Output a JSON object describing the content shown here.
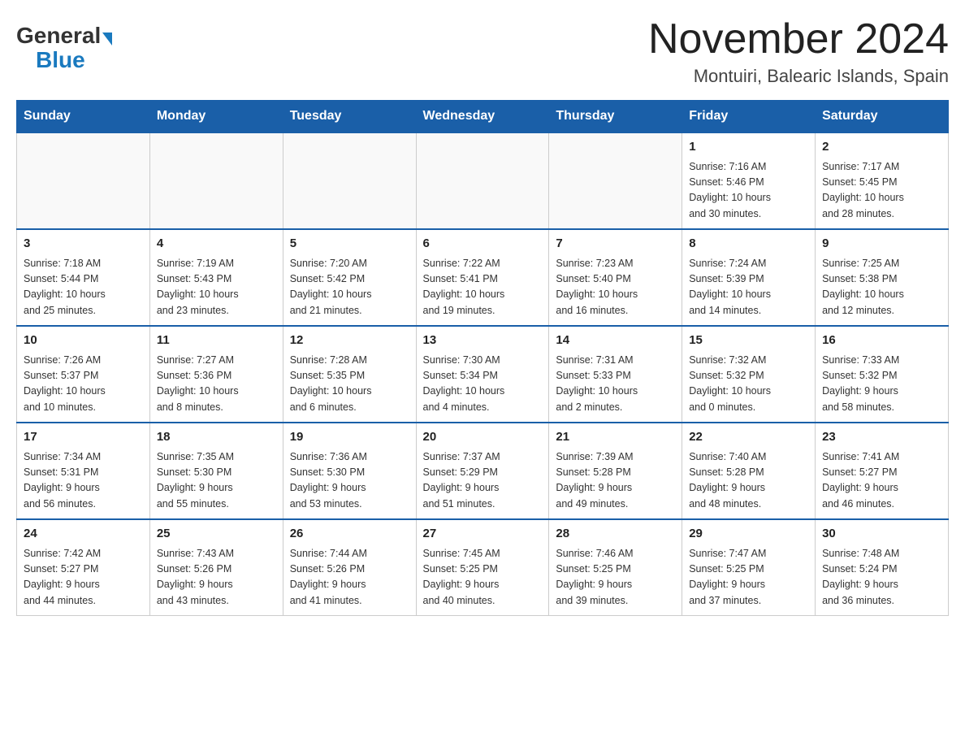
{
  "logo": {
    "general": "General",
    "blue": "Blue"
  },
  "title": "November 2024",
  "subtitle": "Montuiri, Balearic Islands, Spain",
  "weekdays": [
    "Sunday",
    "Monday",
    "Tuesday",
    "Wednesday",
    "Thursday",
    "Friday",
    "Saturday"
  ],
  "weeks": [
    [
      {
        "day": "",
        "info": ""
      },
      {
        "day": "",
        "info": ""
      },
      {
        "day": "",
        "info": ""
      },
      {
        "day": "",
        "info": ""
      },
      {
        "day": "",
        "info": ""
      },
      {
        "day": "1",
        "info": "Sunrise: 7:16 AM\nSunset: 5:46 PM\nDaylight: 10 hours\nand 30 minutes."
      },
      {
        "day": "2",
        "info": "Sunrise: 7:17 AM\nSunset: 5:45 PM\nDaylight: 10 hours\nand 28 minutes."
      }
    ],
    [
      {
        "day": "3",
        "info": "Sunrise: 7:18 AM\nSunset: 5:44 PM\nDaylight: 10 hours\nand 25 minutes."
      },
      {
        "day": "4",
        "info": "Sunrise: 7:19 AM\nSunset: 5:43 PM\nDaylight: 10 hours\nand 23 minutes."
      },
      {
        "day": "5",
        "info": "Sunrise: 7:20 AM\nSunset: 5:42 PM\nDaylight: 10 hours\nand 21 minutes."
      },
      {
        "day": "6",
        "info": "Sunrise: 7:22 AM\nSunset: 5:41 PM\nDaylight: 10 hours\nand 19 minutes."
      },
      {
        "day": "7",
        "info": "Sunrise: 7:23 AM\nSunset: 5:40 PM\nDaylight: 10 hours\nand 16 minutes."
      },
      {
        "day": "8",
        "info": "Sunrise: 7:24 AM\nSunset: 5:39 PM\nDaylight: 10 hours\nand 14 minutes."
      },
      {
        "day": "9",
        "info": "Sunrise: 7:25 AM\nSunset: 5:38 PM\nDaylight: 10 hours\nand 12 minutes."
      }
    ],
    [
      {
        "day": "10",
        "info": "Sunrise: 7:26 AM\nSunset: 5:37 PM\nDaylight: 10 hours\nand 10 minutes."
      },
      {
        "day": "11",
        "info": "Sunrise: 7:27 AM\nSunset: 5:36 PM\nDaylight: 10 hours\nand 8 minutes."
      },
      {
        "day": "12",
        "info": "Sunrise: 7:28 AM\nSunset: 5:35 PM\nDaylight: 10 hours\nand 6 minutes."
      },
      {
        "day": "13",
        "info": "Sunrise: 7:30 AM\nSunset: 5:34 PM\nDaylight: 10 hours\nand 4 minutes."
      },
      {
        "day": "14",
        "info": "Sunrise: 7:31 AM\nSunset: 5:33 PM\nDaylight: 10 hours\nand 2 minutes."
      },
      {
        "day": "15",
        "info": "Sunrise: 7:32 AM\nSunset: 5:32 PM\nDaylight: 10 hours\nand 0 minutes."
      },
      {
        "day": "16",
        "info": "Sunrise: 7:33 AM\nSunset: 5:32 PM\nDaylight: 9 hours\nand 58 minutes."
      }
    ],
    [
      {
        "day": "17",
        "info": "Sunrise: 7:34 AM\nSunset: 5:31 PM\nDaylight: 9 hours\nand 56 minutes."
      },
      {
        "day": "18",
        "info": "Sunrise: 7:35 AM\nSunset: 5:30 PM\nDaylight: 9 hours\nand 55 minutes."
      },
      {
        "day": "19",
        "info": "Sunrise: 7:36 AM\nSunset: 5:30 PM\nDaylight: 9 hours\nand 53 minutes."
      },
      {
        "day": "20",
        "info": "Sunrise: 7:37 AM\nSunset: 5:29 PM\nDaylight: 9 hours\nand 51 minutes."
      },
      {
        "day": "21",
        "info": "Sunrise: 7:39 AM\nSunset: 5:28 PM\nDaylight: 9 hours\nand 49 minutes."
      },
      {
        "day": "22",
        "info": "Sunrise: 7:40 AM\nSunset: 5:28 PM\nDaylight: 9 hours\nand 48 minutes."
      },
      {
        "day": "23",
        "info": "Sunrise: 7:41 AM\nSunset: 5:27 PM\nDaylight: 9 hours\nand 46 minutes."
      }
    ],
    [
      {
        "day": "24",
        "info": "Sunrise: 7:42 AM\nSunset: 5:27 PM\nDaylight: 9 hours\nand 44 minutes."
      },
      {
        "day": "25",
        "info": "Sunrise: 7:43 AM\nSunset: 5:26 PM\nDaylight: 9 hours\nand 43 minutes."
      },
      {
        "day": "26",
        "info": "Sunrise: 7:44 AM\nSunset: 5:26 PM\nDaylight: 9 hours\nand 41 minutes."
      },
      {
        "day": "27",
        "info": "Sunrise: 7:45 AM\nSunset: 5:25 PM\nDaylight: 9 hours\nand 40 minutes."
      },
      {
        "day": "28",
        "info": "Sunrise: 7:46 AM\nSunset: 5:25 PM\nDaylight: 9 hours\nand 39 minutes."
      },
      {
        "day": "29",
        "info": "Sunrise: 7:47 AM\nSunset: 5:25 PM\nDaylight: 9 hours\nand 37 minutes."
      },
      {
        "day": "30",
        "info": "Sunrise: 7:48 AM\nSunset: 5:24 PM\nDaylight: 9 hours\nand 36 minutes."
      }
    ]
  ]
}
